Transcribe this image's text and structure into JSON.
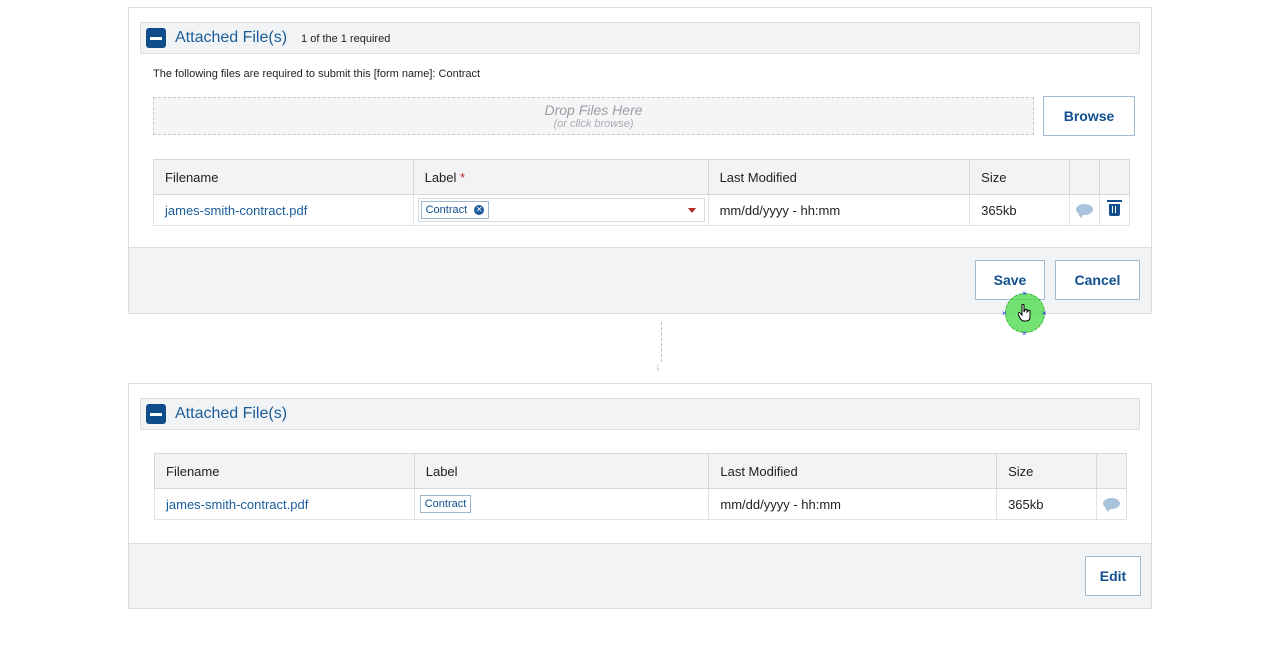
{
  "edit_panel": {
    "title": "Attached File(s)",
    "count_text": "1 of the 1 required",
    "note": "The following files are required to submit this [form name]: Contract",
    "dropzone": {
      "main": "Drop Files Here",
      "sub": "(or click browse)"
    },
    "browse_label": "Browse",
    "columns": [
      "Filename",
      "Label",
      "Last Modified",
      "Size"
    ],
    "required_mark": "*",
    "row": {
      "filename": "james-smith-contract.pdf",
      "label_tag": "Contract",
      "modified": "mm/dd/yyyy - hh:mm",
      "size": "365kb"
    },
    "save_label": "Save",
    "cancel_label": "Cancel"
  },
  "view_panel": {
    "title": "Attached File(s)",
    "columns": [
      "Filename",
      "Label",
      "Last Modified",
      "Size"
    ],
    "row": {
      "filename": "james-smith-contract.pdf",
      "label_tag": "Contract",
      "modified": "mm/dd/yyyy - hh:mm",
      "size": "365kb"
    },
    "edit_label": "Edit"
  },
  "colors": {
    "brand": "#0f4d8a",
    "link": "#1b5c9c",
    "required": "#c0262d",
    "click_indicator": "#50dc50"
  },
  "icons": [
    "collapse-icon",
    "remove-tag-icon",
    "dropdown-caret-icon",
    "comment-icon",
    "trash-icon",
    "down-arrow-icon",
    "hand-cursor-icon"
  ]
}
